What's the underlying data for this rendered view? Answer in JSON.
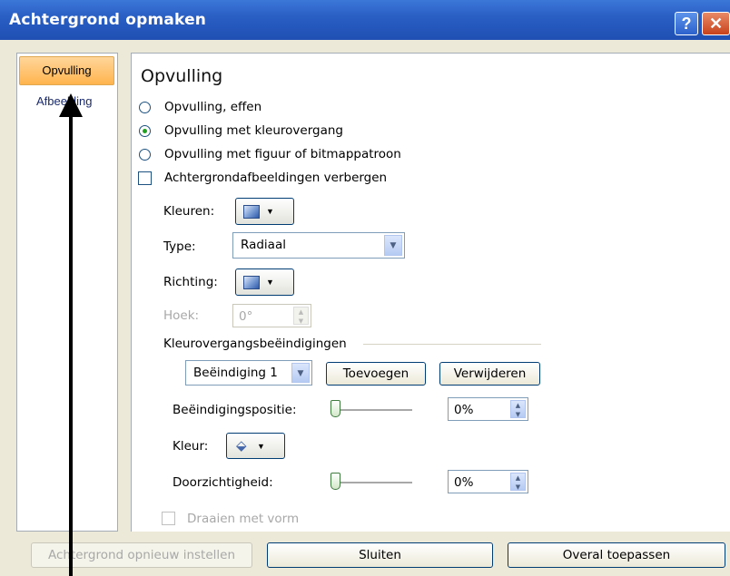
{
  "window": {
    "title": "Achtergrond opmaken",
    "help_glyph": "?",
    "close_glyph": "✕"
  },
  "nav": {
    "items": [
      {
        "label": "Opvulling",
        "selected": true
      },
      {
        "label": "Afbeelding",
        "selected": false
      }
    ]
  },
  "panel": {
    "heading": "Opvulling",
    "fill_options": [
      {
        "label": "Opvulling, effen",
        "checked": false
      },
      {
        "label": "Opvulling met kleurovergang",
        "checked": true
      },
      {
        "label": "Opvulling met figuur of bitmappatroon",
        "checked": false
      }
    ],
    "hide_background": {
      "label": "Achtergrondafbeeldingen verbergen",
      "checked": false
    },
    "colors_label": "Kleuren:",
    "type_label": "Type:",
    "type_value": "Radiaal",
    "direction_label": "Richting:",
    "angle_label": "Hoek:",
    "angle_value": "0°",
    "stops_section": "Kleurovergangsbeëindigingen",
    "stop_select": "Beëindiging 1",
    "add_button": "Toevoegen",
    "remove_button": "Verwijderen",
    "stop_position_label": "Beëindigingspositie:",
    "stop_position_value": "0%",
    "color_label": "Kleur:",
    "transparency_label": "Doorzichtigheid:",
    "transparency_value": "0%",
    "rotate_label": "Draaien met vorm"
  },
  "footer": {
    "reset_button": "Achtergrond opnieuw instellen",
    "close_button": "Sluiten",
    "apply_all_button": "Overal toepassen"
  },
  "icons": {
    "dropdown": "▼",
    "spin_up": "▲",
    "spin_down": "▼",
    "paint_bucket": "⬙"
  },
  "colors": {
    "title_bar": "#2a5fc4",
    "selected_nav": "#ffb44e",
    "frame": "#ece9d8",
    "radio_checked": "#21a121"
  }
}
